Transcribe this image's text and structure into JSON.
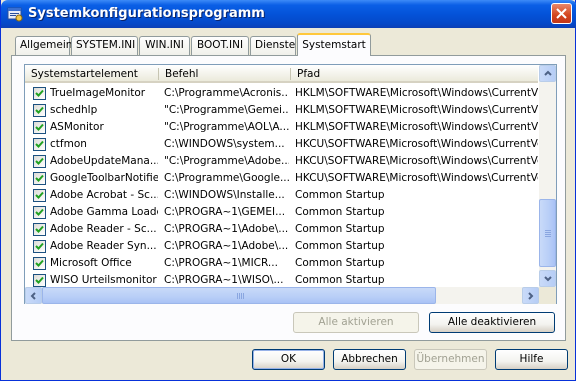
{
  "window": {
    "title": "Systemkonfigurationsprogramm"
  },
  "tabs": [
    {
      "label": "Allgemein",
      "active": false
    },
    {
      "label": "SYSTEM.INI",
      "active": false
    },
    {
      "label": "WIN.INI",
      "active": false
    },
    {
      "label": "BOOT.INI",
      "active": false
    },
    {
      "label": "Dienste",
      "active": false
    },
    {
      "label": "Systemstart",
      "active": true
    }
  ],
  "list": {
    "columns": [
      "Systemstartelement",
      "Befehl",
      "Pfad"
    ],
    "rows": [
      {
        "checked": true,
        "item": "TrueImageMonitor",
        "command": "C:\\Programme\\Acronis...",
        "path": "HKLM\\SOFTWARE\\Microsoft\\Windows\\CurrentVers"
      },
      {
        "checked": true,
        "item": "schedhlp",
        "command": "\"C:\\Programme\\Gemei...",
        "path": "HKLM\\SOFTWARE\\Microsoft\\Windows\\CurrentVers"
      },
      {
        "checked": true,
        "item": "ASMonitor",
        "command": "\"C:\\Programme\\AOL\\A...",
        "path": "HKLM\\SOFTWARE\\Microsoft\\Windows\\CurrentVers"
      },
      {
        "checked": true,
        "item": "ctfmon",
        "command": "C:\\WINDOWS\\system...",
        "path": "HKCU\\SOFTWARE\\Microsoft\\Windows\\CurrentVers"
      },
      {
        "checked": true,
        "item": "AdobeUpdateMana...",
        "command": "\"C:\\Programme\\Adobe...",
        "path": "HKCU\\SOFTWARE\\Microsoft\\Windows\\CurrentVers"
      },
      {
        "checked": true,
        "item": "GoogleToolbarNotifier",
        "command": "C:\\Programme\\Google...",
        "path": "HKCU\\SOFTWARE\\Microsoft\\Windows\\CurrentVers"
      },
      {
        "checked": true,
        "item": "Adobe Acrobat - Sc...",
        "command": "C:\\WINDOWS\\Installe...",
        "path": "Common Startup"
      },
      {
        "checked": true,
        "item": "Adobe Gamma Loader",
        "command": "C:\\PROGRA~1\\GEMEI...",
        "path": "Common Startup"
      },
      {
        "checked": true,
        "item": "Adobe Reader - Sc...",
        "command": "C:\\PROGRA~1\\Adobe\\...",
        "path": "Common Startup"
      },
      {
        "checked": true,
        "item": "Adobe Reader Syn...",
        "command": "C:\\PROGRA~1\\Adobe\\...",
        "path": "Common Startup"
      },
      {
        "checked": true,
        "item": "Microsoft Office",
        "command": "C:\\PROGRA~1\\MICR...",
        "path": "Common Startup"
      },
      {
        "checked": true,
        "item": "WISO Urteilsmonitor",
        "command": "C:\\PROGRA~1\\WISO\\...",
        "path": "Common Startup"
      }
    ]
  },
  "buttons": {
    "enable_all": "Alle aktivieren",
    "disable_all": "Alle deaktivieren",
    "ok": "OK",
    "cancel": "Abbrechen",
    "apply": "Übernehmen",
    "help": "Hilfe"
  }
}
